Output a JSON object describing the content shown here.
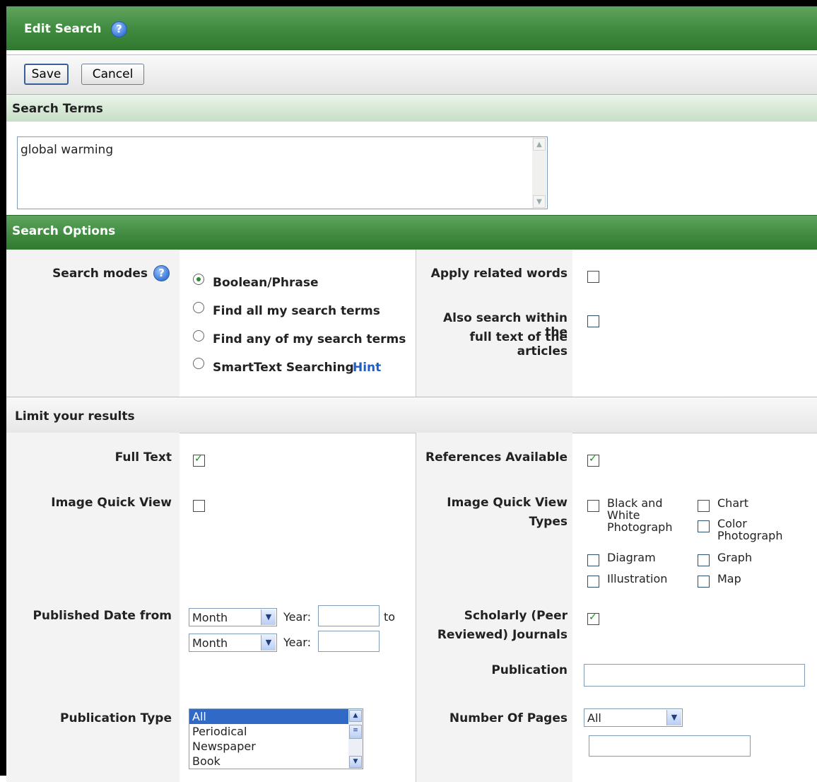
{
  "header": {
    "title": "Edit Search",
    "help_icon": "?"
  },
  "toolbar": {
    "save_label": "Save",
    "cancel_label": "Cancel"
  },
  "search_terms": {
    "section_title": "Search Terms",
    "value": "global warming"
  },
  "search_options": {
    "section_title": "Search Options",
    "modes_label": "Search modes",
    "modes": [
      {
        "label": "Boolean/Phrase",
        "selected": true
      },
      {
        "label": "Find all my search terms",
        "selected": false
      },
      {
        "label": "Find any of my search terms",
        "selected": false
      },
      {
        "label": "SmartText Searching",
        "selected": false
      }
    ],
    "hint_label": "Hint",
    "apply_related_label": "Apply related words",
    "apply_related_checked": false,
    "full_text_search_label_1": "Also search within the",
    "full_text_search_label_2": "full text of the articles",
    "full_text_search_checked": false
  },
  "limits": {
    "section_title": "Limit your results",
    "full_text_label": "Full Text",
    "full_text_checked": true,
    "references_label": "References Available",
    "references_checked": true,
    "image_quick_view_label": "Image Quick View",
    "image_quick_view_checked": false,
    "iqv_types_label_1": "Image Quick View",
    "iqv_types_label_2": "Types",
    "iqv_types": {
      "bw_1": "Black and",
      "bw_2": "White",
      "bw_3": "Photograph",
      "chart": "Chart",
      "color_1": "Color",
      "color_2": "Photograph",
      "diagram": "Diagram",
      "graph": "Graph",
      "illustration": "Illustration",
      "map": "Map"
    },
    "published_from_label": "Published Date from",
    "month_placeholder": "Month",
    "year_label": "Year:",
    "to_label": "to",
    "scholarly_label_1": "Scholarly (Peer",
    "scholarly_label_2": "Reviewed) Journals",
    "scholarly_checked": true,
    "publication_label": "Publication",
    "publication_type_label": "Publication Type",
    "publication_types": [
      "All",
      "Periodical",
      "Newspaper",
      "Book"
    ],
    "pages_label": "Number Of Pages",
    "pages_value": "All"
  }
}
